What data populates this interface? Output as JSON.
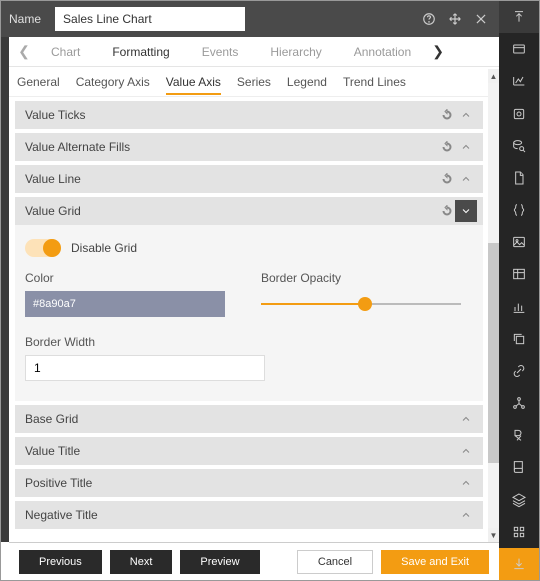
{
  "header": {
    "name_label": "Name",
    "name_value": "Sales Line Chart"
  },
  "primary_tabs": [
    "Chart",
    "Formatting",
    "Events",
    "Hierarchy",
    "Annotation"
  ],
  "primary_active": 1,
  "secondary_tabs": [
    "General",
    "Category Axis",
    "Value Axis",
    "Series",
    "Legend",
    "Trend Lines"
  ],
  "secondary_active": 2,
  "accordion_top": [
    {
      "label": "Value Ticks"
    },
    {
      "label": "Value Alternate Fills"
    },
    {
      "label": "Value Line"
    },
    {
      "label": "Value Grid",
      "expanded": true
    }
  ],
  "value_grid": {
    "disable_label": "Disable Grid",
    "color_label": "Color",
    "color_value": "#8a90a7",
    "opacity_label": "Border Opacity",
    "opacity_percent": 52,
    "width_label": "Border Width",
    "width_value": "1"
  },
  "accordion_bottom": [
    {
      "label": "Base Grid"
    },
    {
      "label": "Value Title"
    },
    {
      "label": "Positive Title"
    },
    {
      "label": "Negative Title"
    }
  ],
  "footer": {
    "previous": "Previous",
    "next": "Next",
    "preview": "Preview",
    "cancel": "Cancel",
    "save": "Save and Exit"
  },
  "right_icons": [
    "collapse",
    "card",
    "chart",
    "widget",
    "search-db",
    "file",
    "braces",
    "image",
    "table",
    "bar-chart",
    "copy",
    "link",
    "network",
    "rx",
    "book",
    "layers",
    "grid-menu",
    "download"
  ]
}
